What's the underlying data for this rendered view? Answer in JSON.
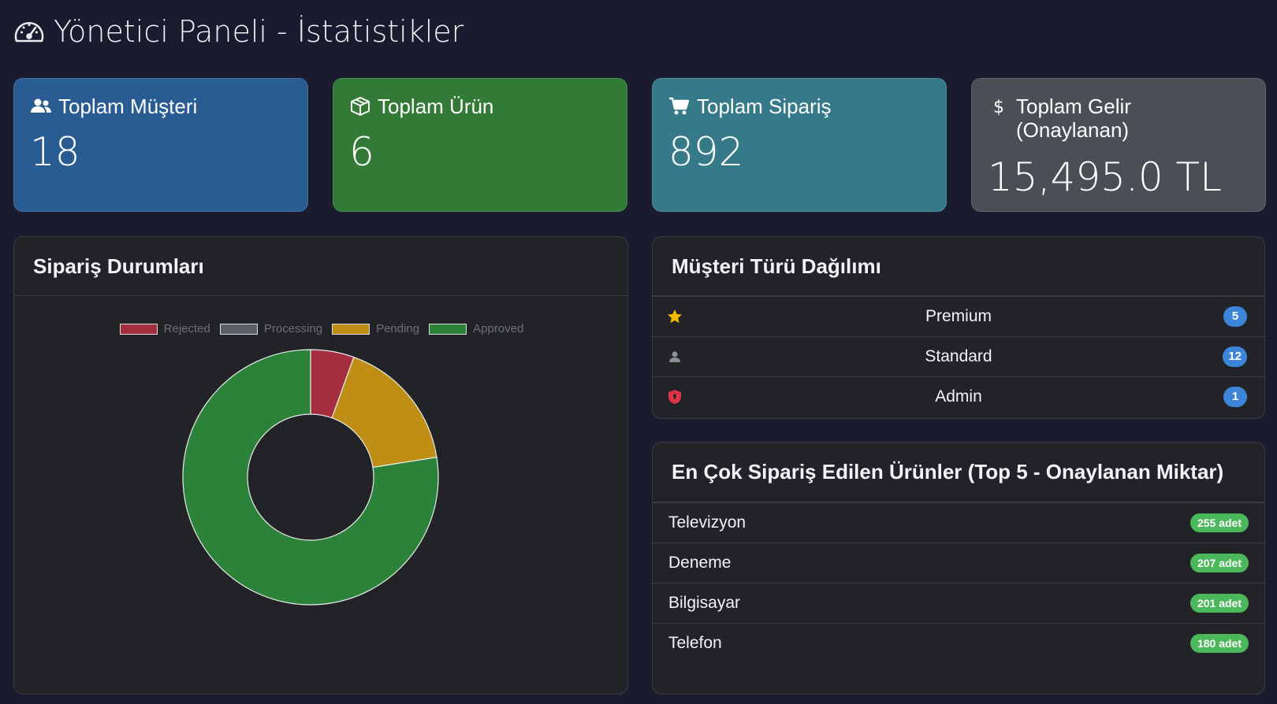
{
  "header": {
    "title": "Yönetici Paneli - İstatistikler",
    "icon": "speedometer-icon"
  },
  "stats": [
    {
      "label": "Toplam Müşteri",
      "value": "18",
      "icon": "users-icon",
      "color": "#2a5c94"
    },
    {
      "label": "Toplam Ürün",
      "value": "6",
      "icon": "box-icon",
      "color": "#327a36"
    },
    {
      "label": "Toplam Sipariş",
      "value": "892",
      "icon": "cart-icon",
      "color": "#367a8a"
    },
    {
      "label": "Toplam Gelir (Onaylanan)",
      "value": "15,495.0 TL",
      "icon": "dollar-icon",
      "color": "#4a4f55"
    }
  ],
  "order_status": {
    "title": "Sipariş Durumları"
  },
  "chart_data": {
    "type": "pie",
    "donut": true,
    "categories": [
      "Rejected",
      "Processing",
      "Pending",
      "Approved"
    ],
    "values": [
      5.5,
      0,
      17,
      77.5
    ],
    "colors": [
      "#a52e3e",
      "#5a5f66",
      "#bf8e14",
      "#2b8238"
    ],
    "legend": "top"
  },
  "customer_types": {
    "title": "Müşteri Türü Dağılımı",
    "items": [
      {
        "label": "Premium",
        "count": "5",
        "icon": "star-icon"
      },
      {
        "label": "Standard",
        "count": "12",
        "icon": "user-icon"
      },
      {
        "label": "Admin",
        "count": "1",
        "icon": "shield-icon"
      }
    ]
  },
  "top_products": {
    "title": "En Çok Sipariş Edilen Ürünler (Top 5 - Onaylanan Miktar)",
    "items": [
      {
        "name": "Televizyon",
        "qty": "255 adet"
      },
      {
        "name": "Deneme",
        "qty": "207 adet"
      },
      {
        "name": "Bilgisayar",
        "qty": "201 adet"
      },
      {
        "name": "Telefon",
        "qty": "180 adet"
      }
    ]
  }
}
